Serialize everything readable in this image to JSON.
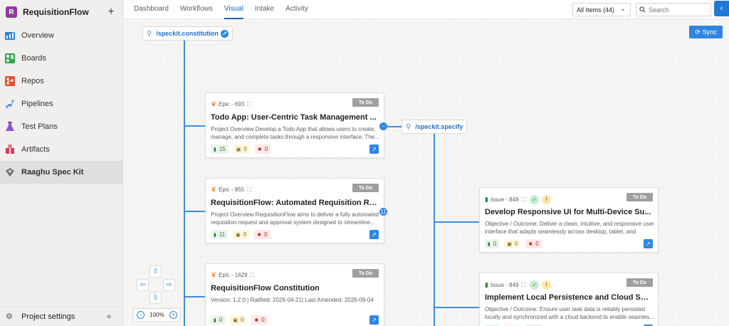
{
  "project": {
    "badge": "R",
    "name": "RequisitionFlow",
    "add": "+"
  },
  "sidebar": {
    "items": [
      {
        "label": "Overview"
      },
      {
        "label": "Boards"
      },
      {
        "label": "Repos"
      },
      {
        "label": "Pipelines"
      },
      {
        "label": "Test Plans"
      },
      {
        "label": "Artifacts"
      },
      {
        "label": "Raaghu Spec Kit"
      }
    ],
    "settings": "Project settings",
    "collapse": "«"
  },
  "tabs": [
    "Dashboard",
    "Workflows",
    "Visual",
    "Intake",
    "Activity"
  ],
  "filter": {
    "value": "All Items (44)"
  },
  "search": {
    "placeholder": "Search"
  },
  "sync_label": "Sync",
  "nodes": {
    "constitution": "/speckit.constitution",
    "specify": "/speckit.specify"
  },
  "cards": [
    {
      "type": "Epic - 693",
      "status": "To Do",
      "title": "Todo App: User-Centric Task Management ...",
      "desc": "Project Overview Develop a Todo App that allows users to create, manage, and complete tasks through a responsive interface. The...",
      "green": "15",
      "yellow": "0",
      "red": "0"
    },
    {
      "type": "Epic - 855",
      "status": "To Do",
      "title": "RequisitionFlow: Automated Requisition Re...",
      "desc": "Project Overview RequisitionFlow aims to deliver a fully automated requisition request and approval system designed to streamline...",
      "green": "11",
      "yellow": "0",
      "red": "0",
      "badge": "11"
    },
    {
      "type": "Epic - 1629",
      "status": "To Do",
      "title": "RequisitionFlow Constitution",
      "desc": "Version: 1.2.0 | Ratified: 2026-04-21| Last Amended: 2026-08-04",
      "green": "0",
      "yellow": "0",
      "red": "0"
    },
    {
      "type": "Issue - 848",
      "status": "To Do",
      "title": "Develop Responsive UI for Multi-Device Su...",
      "desc": "Objective / Outcome: Deliver a clean, intuitive, and responsive user interface that adapts seamlessly across desktop, tablet, and mobi...",
      "green": "0",
      "yellow": "0",
      "red": "0"
    },
    {
      "type": "Issue - 849",
      "status": "To Do",
      "title": "Implement Local Persistence and Cloud Syn...",
      "desc": "Objective / Outcome: Ensure user task data is reliably persisted locally and synchronized with a cloud backend to enable seamles...",
      "green": "0",
      "yellow": "0",
      "red": "0"
    }
  ],
  "zoom": {
    "level": "100%",
    "minus": "−",
    "plus": "+"
  },
  "colors": {
    "accent": "#2f86e0",
    "line": "#3b8ee0",
    "status": "#a19f9d",
    "epic": "#d67f16"
  }
}
